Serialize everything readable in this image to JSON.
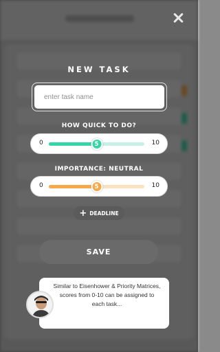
{
  "background": {
    "header_title": "",
    "rows": 8
  },
  "modal": {
    "title": "NEW TASK",
    "task_input": {
      "placeholder": "enter task name",
      "value": ""
    },
    "speed": {
      "label": "HOW QUICK TO DO?",
      "min": "0",
      "max": "10",
      "value": "5",
      "fraction": 0.5,
      "color": "#35d6a6"
    },
    "importance": {
      "label": "IMPORTANCE: NEUTRAL",
      "min": "0",
      "max": "10",
      "value": "5",
      "fraction": 0.5,
      "color": "#f5a94a"
    },
    "deadline_label": "DEADLINE",
    "save_label": "SAVE",
    "tip_text": "Similar to Eisenhower & Priority Matrices, scores from 0-10 can be assigned to each task..."
  },
  "icons": {
    "close": "close-icon",
    "plus": "plus-icon",
    "avatar": "user-avatar-icon"
  }
}
